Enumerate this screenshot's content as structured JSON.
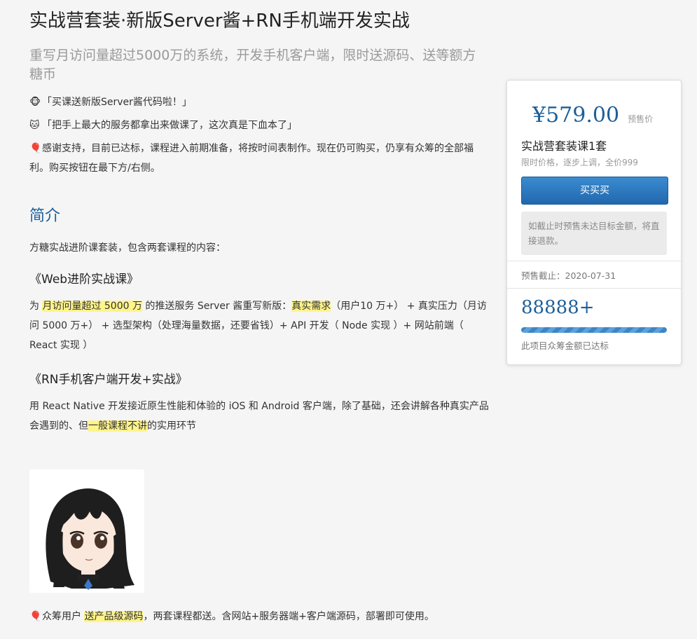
{
  "header": {
    "title": "实战营套装·新版Server酱+RN手机端开发实战",
    "subtitle": "重写月访问量超过5000万的系统，开发手机客户端，限时送源码、送等额方糖币"
  },
  "notes": [
    {
      "icon": "monkey-icon",
      "glyph": "🐵",
      "text": "「买课送新版Server酱代码啦！」"
    },
    {
      "icon": "cat-icon",
      "glyph": "🐱",
      "text": "「把手上最大的服务都拿出来做课了，这次真是下血本了」"
    },
    {
      "icon": "balloon-icon",
      "glyph": "🎈",
      "text": "感谢支持，目前已达标，课程进入前期准备，将按时间表制作。现在仍可购买，仍享有众筹的全部福利。购买按钮在最下方/右侧。"
    }
  ],
  "intro": {
    "heading": "简介",
    "text": "方糖实战进阶课套装，包含两套课程的内容："
  },
  "course1": {
    "title": "《Web进阶实战课》",
    "p1": "为 ",
    "h1": "月访问量超过 5000 万",
    "p2": " 的推送服务 Server 酱重写新版：",
    "h2": "真实需求",
    "p3": "（用户10 万+） + 真实压力（月访问 5000 万+） + 选型架构（处理海量数据，还要省钱）+ API 开发（ Node 实现 ）+ 网站前端（ React 实现 ）"
  },
  "course2": {
    "title": "《RN手机客户端开发+实战》",
    "p1": "用 React Native 开发接近原生性能和体验的 iOS 和 Android 客户端，除了基础，还会讲解各种真实产品会遇到的、但",
    "h1": "一般课程不讲",
    "p2": "的实用环节"
  },
  "footer_note": {
    "glyph": "🎈",
    "p1": "众筹用户 ",
    "h1": "送产品级源码",
    "p2": "，两套课程都送。含网站+服务器端+客户端源码，部署即可使用。"
  },
  "sidebar": {
    "price": "¥579.00",
    "price_tag": "预售价",
    "package_title": "实战营套装课1套",
    "package_note": "限时价格，逐步上调，全价999",
    "buy_label": "买买买",
    "refund_note": "如截止时预售未达目标金额，将直接退款。",
    "deadline": "预售截止：2020-07-31",
    "count": "88888+",
    "progress": 1.0,
    "reached_label": "此项目众筹金额已达标"
  },
  "colors": {
    "accent": "#1d5f9a",
    "button": "#2a74bb",
    "highlight": "#fff48a",
    "background": "#f5f5f5"
  }
}
